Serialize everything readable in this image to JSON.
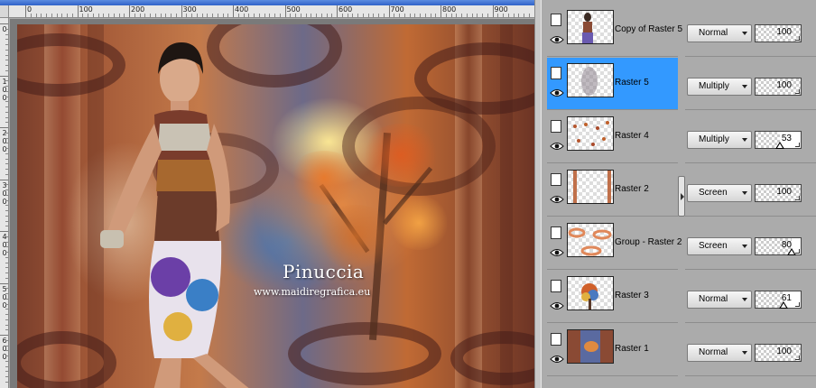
{
  "ruler": {
    "top_labels": [
      "0",
      "100",
      "200",
      "300",
      "400",
      "500",
      "600",
      "700",
      "800",
      "900"
    ],
    "left_labels": [
      "0",
      "1\n0\n0",
      "2\n0\n0",
      "3\n0\n0",
      "4\n0\n0",
      "5\n0\n0",
      "6\n0\n0"
    ]
  },
  "canvas": {
    "watermark_title": "Pinuccia",
    "watermark_url": "www.maidiregrafica.eu"
  },
  "layers": [
    {
      "name": "Copy of Raster 5",
      "blend_mode": "Normal",
      "opacity": 100,
      "selected": false,
      "thumb": "woman"
    },
    {
      "name": "Raster 5",
      "blend_mode": "Multiply",
      "opacity": 100,
      "selected": true,
      "thumb": "blur"
    },
    {
      "name": "Raster 4",
      "blend_mode": "Multiply",
      "opacity": 53,
      "selected": false,
      "thumb": "leaves"
    },
    {
      "name": "Raster 2",
      "blend_mode": "Screen",
      "opacity": 100,
      "selected": false,
      "thumb": "stripes"
    },
    {
      "name": "Group - Raster 2",
      "blend_mode": "Screen",
      "opacity": 80,
      "selected": false,
      "thumb": "orange-swirl"
    },
    {
      "name": "Raster 3",
      "blend_mode": "Normal",
      "opacity": 61,
      "selected": false,
      "thumb": "tree"
    },
    {
      "name": "Raster 1",
      "blend_mode": "Normal",
      "opacity": 100,
      "selected": false,
      "thumb": "background"
    }
  ],
  "colors": {
    "selection": "#3399ff",
    "panel": "#ababab"
  }
}
